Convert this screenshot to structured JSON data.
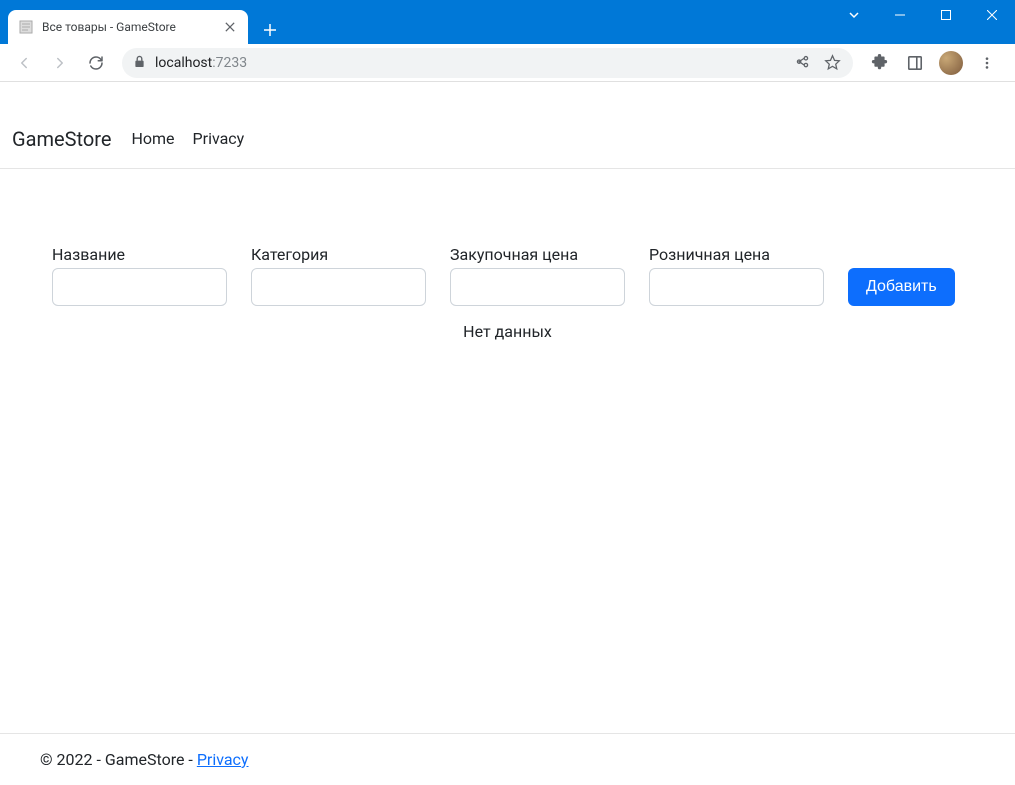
{
  "browser": {
    "tab_title": "Все товары - GameStore",
    "url_host": "localhost",
    "url_port": ":7233"
  },
  "site": {
    "brand": "GameStore",
    "nav": {
      "home": "Home",
      "privacy": "Privacy"
    },
    "footer_text": "© 2022 - GameStore - ",
    "footer_privacy": "Privacy"
  },
  "filters": {
    "name_label": "Название",
    "category_label": "Категория",
    "purchase_price_label": "Закупочная цена",
    "retail_price_label": "Розничная цена",
    "add_button": "Добавить"
  },
  "messages": {
    "no_data": "Нет данных"
  }
}
